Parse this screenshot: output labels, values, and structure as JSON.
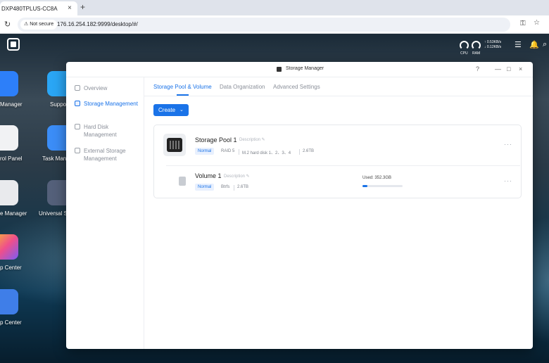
{
  "browser": {
    "tab_title": "DXP480TPLUS-CC8A",
    "tab_close": "×",
    "new_tab": "+",
    "security_label": "Not secure",
    "url": "176.16.254.182:9999/desktop/#/"
  },
  "tray": {
    "cpu_label": "CPU",
    "ram_label": "RAM",
    "upload_speed": "↑ 0.53KB/s",
    "download_speed": "↓ 0.12KB/s"
  },
  "desktop_icons": [
    {
      "label": "Manager"
    },
    {
      "label": "Suppo"
    },
    {
      "label": "rol Panel"
    },
    {
      "label": "Task Man"
    },
    {
      "label": "e Manager"
    },
    {
      "label": "Universal S"
    },
    {
      "label": "p Center"
    },
    {
      "label": "p Center"
    }
  ],
  "window": {
    "title": "Storage Manager",
    "help": "?",
    "minimize": "—",
    "maximize": "□",
    "close": "×"
  },
  "sidebar": {
    "items": [
      {
        "label": "Overview",
        "active": false
      },
      {
        "label": "Storage Management",
        "active": true
      },
      {
        "label": "Hard Disk Management",
        "active": false
      },
      {
        "label": "External Storage Management",
        "active": false
      }
    ]
  },
  "tabs": [
    {
      "label": "Storage Pool & Volume",
      "active": true
    },
    {
      "label": "Data Organization",
      "active": false
    },
    {
      "label": "Advanced Settings",
      "active": false
    }
  ],
  "create_button": "Create",
  "pool": {
    "name": "Storage Pool 1",
    "description_placeholder": "Description",
    "status": "Normal",
    "raid": "RAID 5",
    "disks": "M.2 hard disk 1、2、3、4",
    "size": "2.6TB",
    "more": "···"
  },
  "volume": {
    "name": "Volume 1",
    "description_placeholder": "Description",
    "status": "Normal",
    "filesystem": "Btrfs",
    "size": "2.6TB",
    "used_label": "Used: 352.3GB",
    "used_fraction": 0.13,
    "more": "···"
  },
  "colors": {
    "accent": "#1a73e8",
    "badge_bg": "#e8f0fe"
  }
}
